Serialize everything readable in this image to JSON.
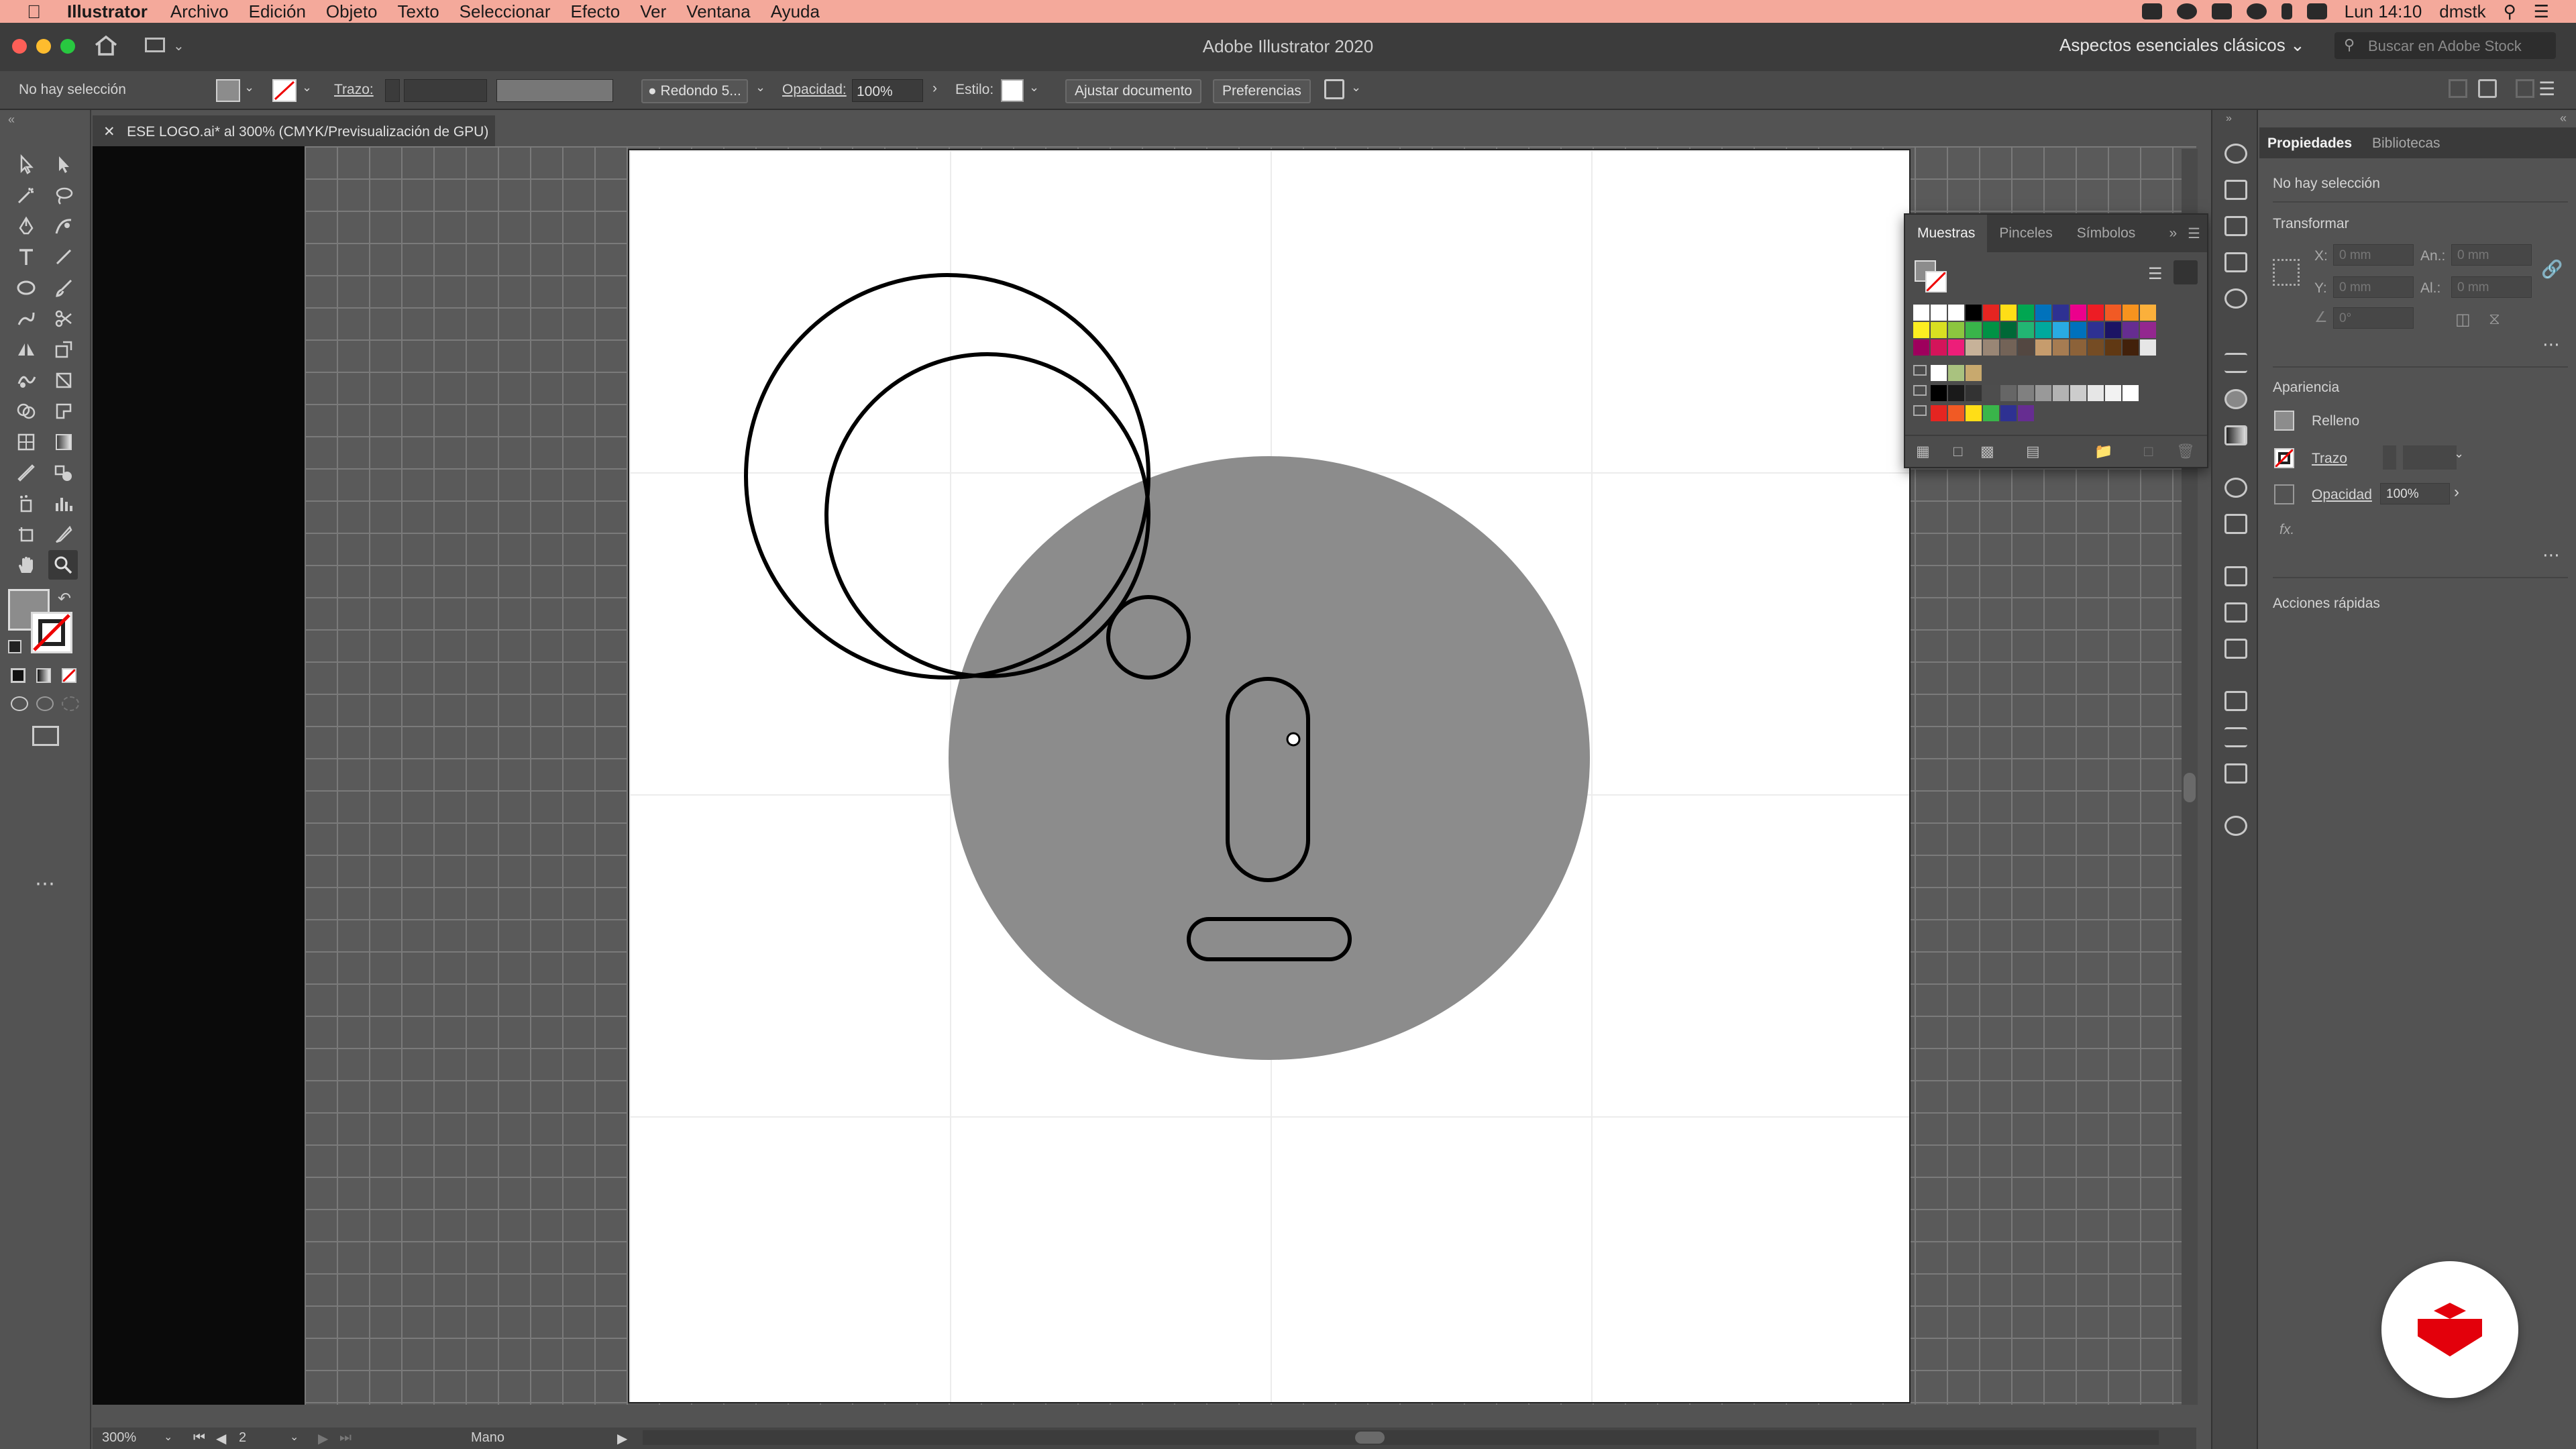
{
  "menubar": {
    "app_name": "Illustrator",
    "menus": [
      "Archivo",
      "Edición",
      "Objeto",
      "Texto",
      "Seleccionar",
      "Efecto",
      "Ver",
      "Ventana",
      "Ayuda"
    ],
    "clock": "Lun 14:10",
    "user": "dmstk"
  },
  "titlebar": {
    "title": "Adobe Illustrator 2020",
    "workspace": "Aspectos esenciales clásicos",
    "stock_placeholder": "Buscar en Adobe Stock"
  },
  "controlbar": {
    "selection": "No hay selección",
    "stroke_label": "Trazo:",
    "brush": "Redondo 5...",
    "opacity_label": "Opacidad:",
    "opacity_value": "100%",
    "style_label": "Estilo:",
    "fit_button": "Ajustar documento",
    "prefs_button": "Preferencias"
  },
  "document": {
    "tab_title": "ESE LOGO.ai* al 300% (CMYK/Previsualización de GPU)"
  },
  "statusbar": {
    "zoom": "300%",
    "page": "2",
    "tool": "Mano"
  },
  "swatches": {
    "tabs": [
      "Muestras",
      "Pinceles",
      "Símbolos"
    ],
    "rows": [
      [
        "#ffffff",
        "#ffffff",
        "#ffffff",
        "#000000",
        "#e52521",
        "#ffde17",
        "#00a651",
        "#0072bc",
        "#2e3192",
        "#ec008c",
        "#ed1c24",
        "#f15a24",
        "#f7931e",
        "#fbb03b"
      ],
      [
        "#fcee21",
        "#d9e021",
        "#8cc63f",
        "#39b54a",
        "#009245",
        "#006837",
        "#22b573",
        "#00a99d",
        "#29abe2",
        "#0071bc",
        "#2e3192",
        "#1b1464",
        "#662d91",
        "#93278f"
      ],
      [
        "#9e005d",
        "#d4145a",
        "#ed1e79",
        "#c7b299",
        "#998675",
        "#736357",
        "#534741",
        "#c69c6d",
        "#a67c52",
        "#8c6239",
        "#754c24",
        "#603813",
        "#42210b",
        "#e6e6e6"
      ],
      [
        "#ffffff",
        "#a9c27f",
        "#c8a96e"
      ],
      [
        "#000000",
        "#1a1a1a",
        "#333333",
        "#4d4d4d",
        "#666666",
        "#808080",
        "#999999",
        "#b3b3b3",
        "#cccccc",
        "#e6e6e6",
        "#f2f2f2",
        "#ffffff"
      ],
      [
        "#e52521",
        "#f15a24",
        "#ffde17",
        "#39b54a",
        "#2e3192",
        "#662d91"
      ]
    ]
  },
  "properties": {
    "tabs": [
      "Propiedades",
      "Bibliotecas"
    ],
    "selection": "No hay selección",
    "transform_title": "Transformar",
    "x_label": "X:",
    "y_label": "Y:",
    "w_label": "An.:",
    "h_label": "Al.:",
    "x_value": "0 mm",
    "y_value": "0 mm",
    "w_value": "0 mm",
    "h_value": "0 mm",
    "angle_value": "0°",
    "appearance_title": "Apariencia",
    "fill_label": "Relleno",
    "stroke_label": "Trazo",
    "opacity_label": "Opacidad",
    "opacity_value": "100%",
    "fx_label": "fx.",
    "quick_actions_title": "Acciones rápidas"
  },
  "colors": {
    "menubar": "#f4a99b",
    "face_fill": "#8c8c8c",
    "stroke": "#000000",
    "badge_red": "#e3000b"
  }
}
